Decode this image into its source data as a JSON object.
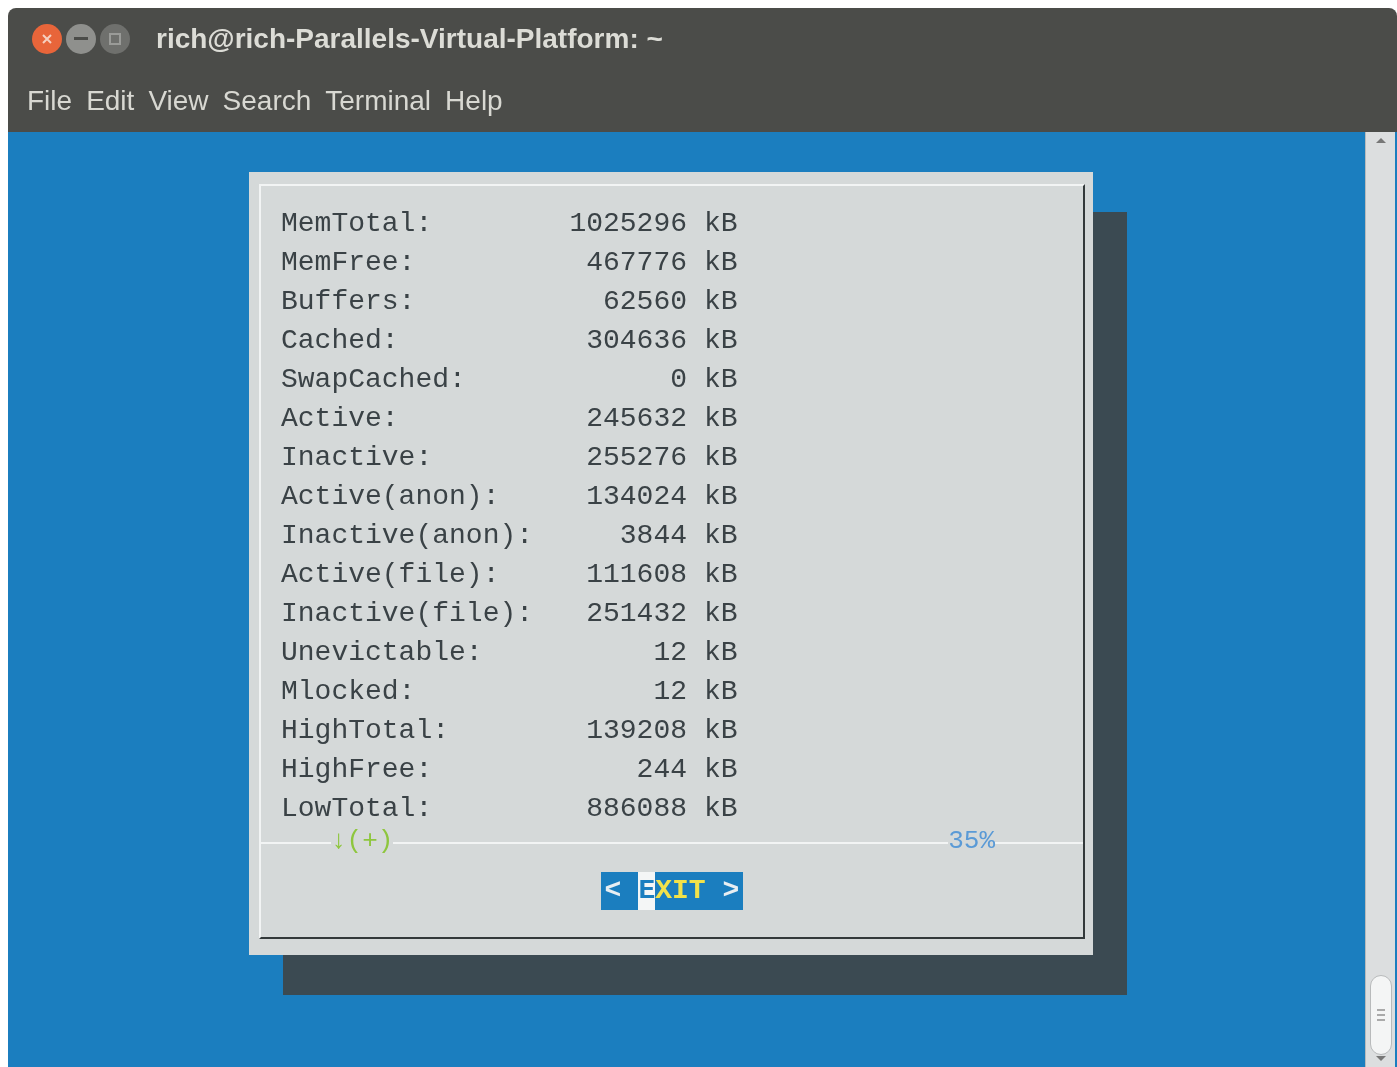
{
  "window": {
    "title": "rich@rich-Parallels-Virtual-Platform: ~"
  },
  "menu": [
    "File",
    "Edit",
    "View",
    "Search",
    "Terminal",
    "Help"
  ],
  "dialog": {
    "rows": [
      {
        "label": "MemTotal:",
        "value": "1025296",
        "unit": "kB"
      },
      {
        "label": "MemFree:",
        "value": "467776",
        "unit": "kB"
      },
      {
        "label": "Buffers:",
        "value": "62560",
        "unit": "kB"
      },
      {
        "label": "Cached:",
        "value": "304636",
        "unit": "kB"
      },
      {
        "label": "SwapCached:",
        "value": "0",
        "unit": "kB"
      },
      {
        "label": "Active:",
        "value": "245632",
        "unit": "kB"
      },
      {
        "label": "Inactive:",
        "value": "255276",
        "unit": "kB"
      },
      {
        "label": "Active(anon):",
        "value": "134024",
        "unit": "kB"
      },
      {
        "label": "Inactive(anon):",
        "value": "3844",
        "unit": "kB"
      },
      {
        "label": "Active(file):",
        "value": "111608",
        "unit": "kB"
      },
      {
        "label": "Inactive(file):",
        "value": "251432",
        "unit": "kB"
      },
      {
        "label": "Unevictable:",
        "value": "12",
        "unit": "kB"
      },
      {
        "label": "Mlocked:",
        "value": "12",
        "unit": "kB"
      },
      {
        "label": "HighTotal:",
        "value": "139208",
        "unit": "kB"
      },
      {
        "label": "HighFree:",
        "value": "244",
        "unit": "kB"
      },
      {
        "label": "LowTotal:",
        "value": "886088",
        "unit": "kB"
      }
    ],
    "scroll_hint": "↓(+)",
    "progress": "35%",
    "button": {
      "left": "<",
      "hotkey": "E",
      "rest": "XIT",
      "right": ">"
    }
  }
}
